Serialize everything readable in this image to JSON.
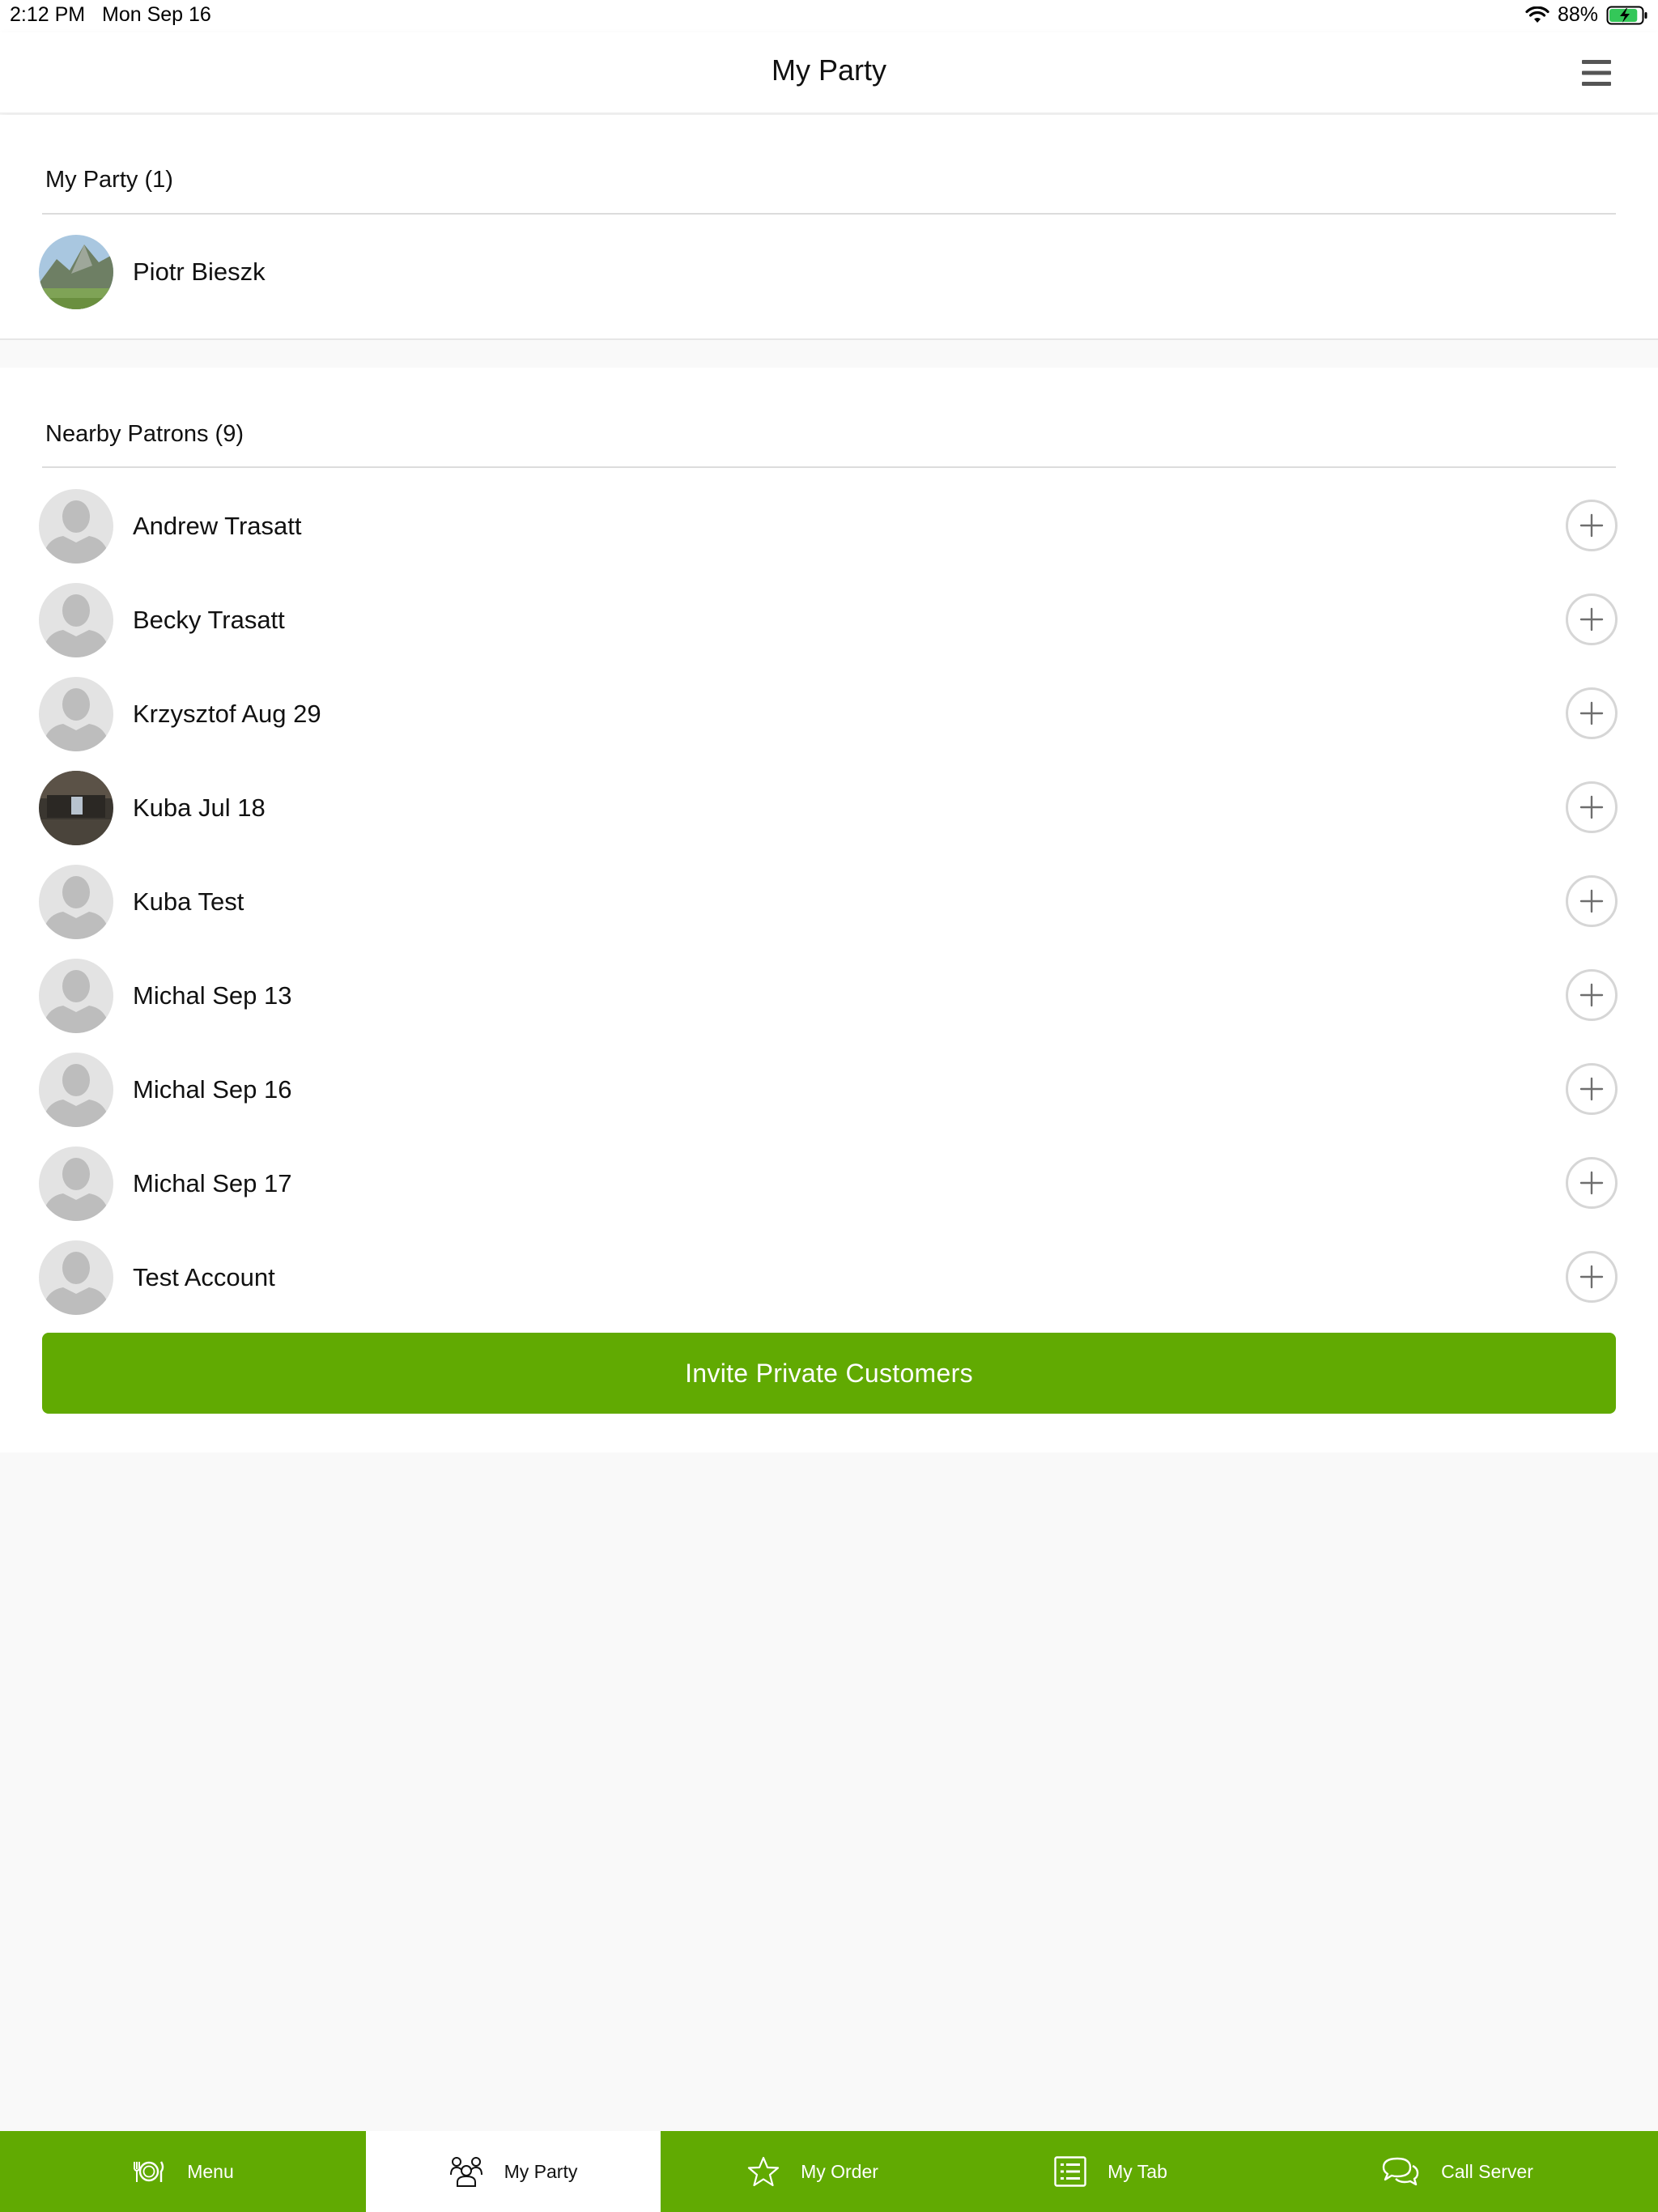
{
  "status_bar": {
    "time": "2:12 PM",
    "date": "Mon Sep 16",
    "battery_percent": "88%",
    "battery_level": 0.88
  },
  "header": {
    "title": "My Party",
    "menu_icon": "hamburger-menu-icon"
  },
  "my_party": {
    "title": "My Party (1)",
    "members": [
      {
        "name": "Piotr Bieszk",
        "avatar": "photo-mountain"
      }
    ]
  },
  "nearby": {
    "title": "Nearby Patrons (9)",
    "patrons": [
      {
        "name": "Andrew Trasatt",
        "avatar": "placeholder"
      },
      {
        "name": "Becky Trasatt",
        "avatar": "placeholder"
      },
      {
        "name": "Krzysztof Aug 29",
        "avatar": "placeholder"
      },
      {
        "name": "Kuba Jul 18",
        "avatar": "photo-dark"
      },
      {
        "name": "Kuba Test",
        "avatar": "placeholder"
      },
      {
        "name": "Michal Sep 13",
        "avatar": "placeholder"
      },
      {
        "name": "Michal Sep 16",
        "avatar": "placeholder"
      },
      {
        "name": "Michal Sep 17",
        "avatar": "placeholder"
      },
      {
        "name": "Test Account",
        "avatar": "placeholder"
      }
    ],
    "invite_label": "Invite Private Customers"
  },
  "tabs": [
    {
      "label": "Menu",
      "icon": "plate-icon",
      "active": false
    },
    {
      "label": "My Party",
      "icon": "group-icon",
      "active": true
    },
    {
      "label": "My Order",
      "icon": "star-icon",
      "active": false
    },
    {
      "label": "My Tab",
      "icon": "list-icon",
      "active": false
    },
    {
      "label": "Call Server",
      "icon": "chat-bubbles-icon",
      "active": false
    }
  ],
  "colors": {
    "accent": "#61aa02",
    "background": "#f9f9f9",
    "divider": "#dcdcdc"
  }
}
